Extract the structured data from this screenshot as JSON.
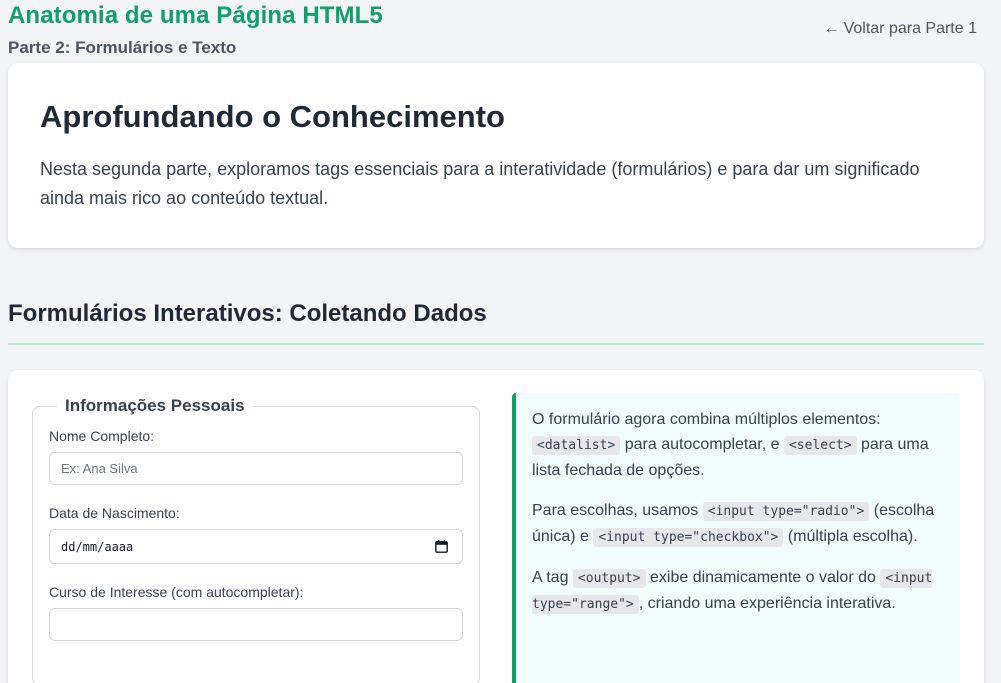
{
  "header": {
    "title": "Anatomia de uma Página HTML5",
    "subtitle": "Parte 2: Formulários e Texto",
    "back_arrow": "←",
    "back_label": "Voltar para Parte 1"
  },
  "intro": {
    "heading": "Aprofundando o Conhecimento",
    "text": "Nesta segunda parte, exploramos tags essenciais para a interatividade (formulários) e para dar um significado ainda mais rico ao conteúdo textual."
  },
  "section": {
    "heading": "Formulários Interativos: Coletando Dados"
  },
  "form": {
    "legend": "Informações Pessoais",
    "name_label": "Nome Completo:",
    "name_placeholder": "Ex: Ana Silva",
    "birth_label": "Data de Nascimento:",
    "birth_value": "dd/mm/aaaa",
    "course_label": "Curso de Interesse (com autocompletar):",
    "course_value": ""
  },
  "info": {
    "p1": {
      "t1": "O formulário agora combina múltiplos elementos: ",
      "c1": "<datalist>",
      "t2": " para autocompletar, e ",
      "c2": "<select>",
      "t3": " para uma lista fechada de opções."
    },
    "p2": {
      "t1": "Para escolhas, usamos ",
      "c1": "<input type=\"radio\">",
      "t2": " (escolha única) e ",
      "c2": "<input type=\"checkbox\">",
      "t3": " (múltipla escolha)."
    },
    "p3": {
      "t1": "A tag ",
      "c1": "<output>",
      "t2": " exibe dinamicamente o valor do ",
      "c2": "<input type=\"range\">",
      "t3": ", criando uma experiência interativa."
    }
  },
  "icons": {
    "calendar": "calendar-icon"
  },
  "colors": {
    "brand": "#10a06a",
    "section_rule": "#a7f3d0",
    "info_bg": "#f0fdfa"
  }
}
